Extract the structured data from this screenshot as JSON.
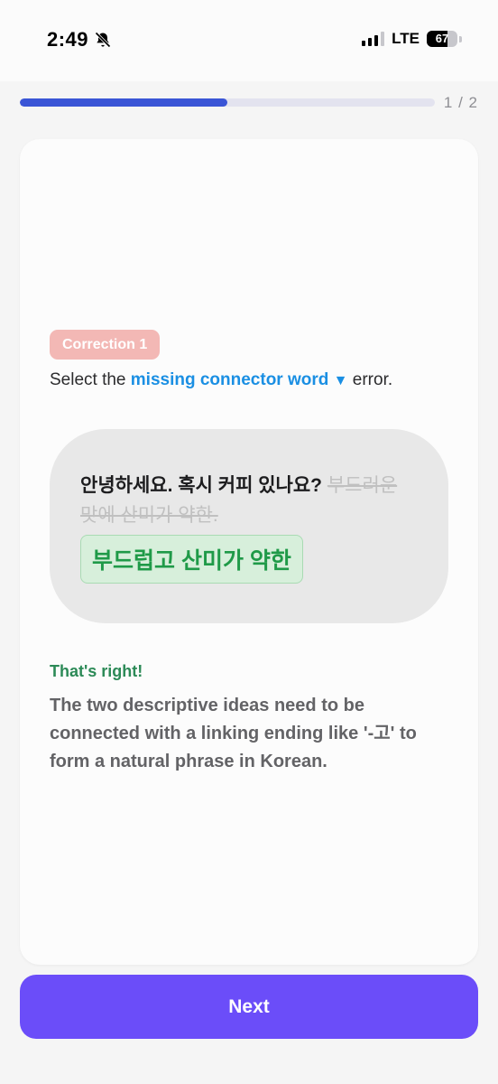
{
  "status_bar": {
    "time": "2:49",
    "network": "LTE",
    "battery": "67",
    "battery_level": 0.67,
    "signal_bars": 3
  },
  "progress": {
    "label": "1 / 2",
    "fraction": 0.5
  },
  "exercise": {
    "badge": "Correction 1",
    "instruction_prefix": "Select the",
    "instruction_link": "missing connector word",
    "instruction_caret": "▼",
    "instruction_suffix": "error.",
    "sentence_plain": "안녕하세요. 혹시 커피 있나요?",
    "sentence_struck": "부드러운 맛에 산미가 약한.",
    "correction": "부드럽고 산미가 약한"
  },
  "feedback": {
    "title": "That's right!",
    "body": "The two descriptive ideas need to be connected with a linking ending like '-고' to form a natural phrase in Korean."
  },
  "actions": {
    "next_label": "Next"
  },
  "colors": {
    "accent": "#6b4df9",
    "progress": "#3a55d6",
    "badge": "#f3b8b5",
    "link": "#1a8fe3",
    "success": "#2c8a57"
  }
}
